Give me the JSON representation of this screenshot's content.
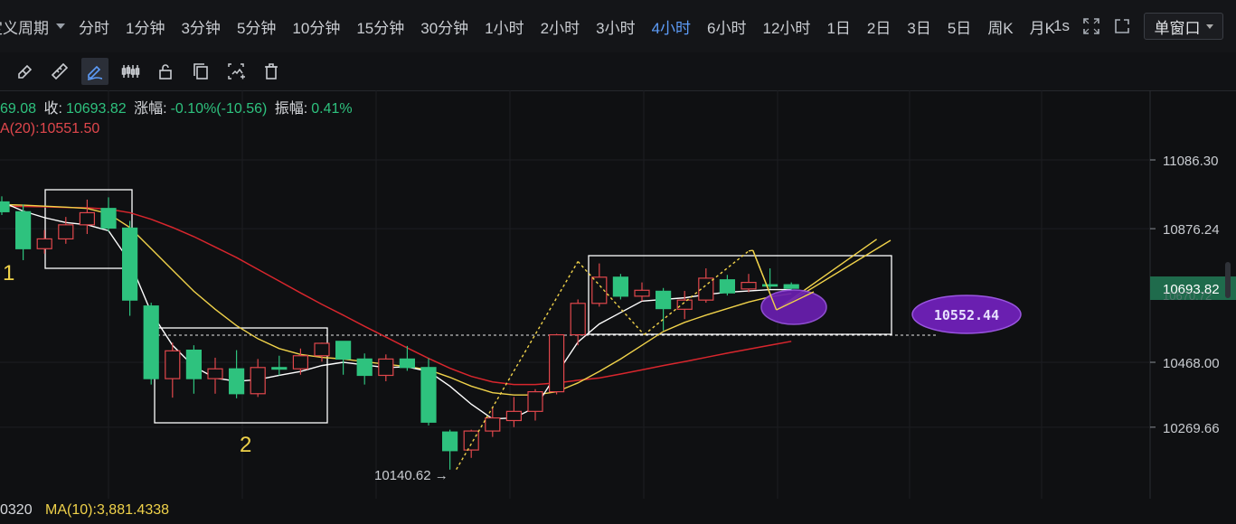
{
  "header": {
    "custom_period_label": "定义周期",
    "timeframes": [
      "分时",
      "1分钟",
      "3分钟",
      "5分钟",
      "10分钟",
      "15分钟",
      "30分钟",
      "1小时",
      "2小时",
      "3小时",
      "4小时",
      "6小时",
      "12小时",
      "1日",
      "2日",
      "3日",
      "5日",
      "周K",
      "月K"
    ],
    "active_timeframe": "4小时",
    "right_refresh": "1s",
    "window_mode": "单窗口"
  },
  "toolbar": {
    "tools": [
      "ruler-eraser-icon",
      "ruler-icon",
      "pen-draw-icon",
      "candle-pattern-icon",
      "lock-icon",
      "copy-icon",
      "screenshot-icon",
      "trash-icon"
    ],
    "active_tool": "pen-draw-icon"
  },
  "info": {
    "open_fragment": "69.08",
    "close_label": "收:",
    "close_value": "10693.82",
    "change_label": "涨幅:",
    "change_value": "-0.10%(-10.56)",
    "amplitude_label": "振幅:",
    "amplitude_value": "0.41%",
    "ma20_fragment": "A(20):10551.50"
  },
  "bottom": {
    "volume_fragment": "0320",
    "ma10_label": "MA(10):3,881.4338"
  },
  "colors": {
    "up": "#e0474c",
    "down": "#2ec27e",
    "ma_fast": "#ffffff",
    "ma_mid": "#f0d24a",
    "ma_slow": "#d8262d",
    "annotation": "#ffffff",
    "accent_purple": "#6a1fb0",
    "price_tag": "#1f6b4c"
  },
  "chart_data": {
    "type": "candlestick",
    "y_ticks": [
      11086.3,
      10876.24,
      10468.0,
      10269.66
    ],
    "y_tick_labels": [
      "11086.30",
      "10876.24",
      "10468.00",
      "10269.66"
    ],
    "ylim": [
      10060,
      11300
    ],
    "current_price_label": "10693.82",
    "current_price_hidden_label": "10670.72",
    "current_price": 10693.82,
    "low_marker_label": "10140.62",
    "low_marker": 10140.62,
    "ellipse_label": "10552.44",
    "support_level": 10552.44,
    "box_labels": [
      "1",
      "2"
    ],
    "candles": [
      {
        "o": 10958,
        "c": 10928,
        "h": 10975,
        "l": 10918
      },
      {
        "o": 10928,
        "c": 10815,
        "h": 10950,
        "l": 10780
      },
      {
        "o": 10815,
        "c": 10845,
        "h": 10872,
        "l": 10800
      },
      {
        "o": 10845,
        "c": 10888,
        "h": 10912,
        "l": 10830
      },
      {
        "o": 10888,
        "c": 10925,
        "h": 10965,
        "l": 10860
      },
      {
        "o": 10938,
        "c": 10878,
        "h": 10972,
        "l": 10868
      },
      {
        "o": 10878,
        "c": 10658,
        "h": 10900,
        "l": 10610
      },
      {
        "o": 10640,
        "c": 10418,
        "h": 10650,
        "l": 10400
      },
      {
        "o": 10418,
        "c": 10503,
        "h": 10528,
        "l": 10360
      },
      {
        "o": 10505,
        "c": 10418,
        "h": 10520,
        "l": 10372
      },
      {
        "o": 10418,
        "c": 10448,
        "h": 10482,
        "l": 10372
      },
      {
        "o": 10448,
        "c": 10372,
        "h": 10505,
        "l": 10358
      },
      {
        "o": 10372,
        "c": 10452,
        "h": 10478,
        "l": 10362
      },
      {
        "o": 10452,
        "c": 10447,
        "h": 10488,
        "l": 10428
      },
      {
        "o": 10448,
        "c": 10488,
        "h": 10510,
        "l": 10430
      },
      {
        "o": 10488,
        "c": 10526,
        "h": 10528,
        "l": 10470
      },
      {
        "o": 10532,
        "c": 10478,
        "h": 10532,
        "l": 10430
      },
      {
        "o": 10478,
        "c": 10428,
        "h": 10495,
        "l": 10400
      },
      {
        "o": 10428,
        "c": 10478,
        "h": 10492,
        "l": 10410
      },
      {
        "o": 10478,
        "c": 10452,
        "h": 10518,
        "l": 10442
      },
      {
        "o": 10452,
        "c": 10285,
        "h": 10480,
        "l": 10275
      },
      {
        "o": 10255,
        "c": 10198,
        "h": 10262,
        "l": 10140
      },
      {
        "o": 10200,
        "c": 10258,
        "h": 10262,
        "l": 10176
      },
      {
        "o": 10258,
        "c": 10298,
        "h": 10330,
        "l": 10240
      },
      {
        "o": 10290,
        "c": 10318,
        "h": 10362,
        "l": 10270
      },
      {
        "o": 10318,
        "c": 10378,
        "h": 10386,
        "l": 10290
      },
      {
        "o": 10378,
        "c": 10552,
        "h": 10555,
        "l": 10370
      },
      {
        "o": 10552,
        "c": 10648,
        "h": 10660,
        "l": 10520
      },
      {
        "o": 10648,
        "c": 10728,
        "h": 10770,
        "l": 10638
      },
      {
        "o": 10728,
        "c": 10670,
        "h": 10738,
        "l": 10660
      },
      {
        "o": 10670,
        "c": 10688,
        "h": 10712,
        "l": 10655
      },
      {
        "o": 10685,
        "c": 10632,
        "h": 10695,
        "l": 10565
      },
      {
        "o": 10630,
        "c": 10658,
        "h": 10686,
        "l": 10600
      },
      {
        "o": 10658,
        "c": 10725,
        "h": 10755,
        "l": 10650
      },
      {
        "o": 10720,
        "c": 10680,
        "h": 10735,
        "l": 10672
      },
      {
        "o": 10692,
        "c": 10712,
        "h": 10738,
        "l": 10682
      },
      {
        "o": 10705,
        "c": 10702,
        "h": 10755,
        "l": 10692
      },
      {
        "o": 10705,
        "c": 10694,
        "h": 10712,
        "l": 10688
      }
    ],
    "ma_fast": [
      10958,
      10930,
      10910,
      10895,
      10888,
      10870,
      10775,
      10620,
      10520,
      10455,
      10420,
      10410,
      10415,
      10428,
      10440,
      10458,
      10468,
      10460,
      10452,
      10454,
      10440,
      10395,
      10340,
      10295,
      10298,
      10330,
      10432,
      10530,
      10585,
      10620,
      10655,
      10660,
      10665,
      10675,
      10682,
      10686,
      10690,
      10690
    ],
    "ma_mid": [
      10950,
      10948,
      10945,
      10942,
      10938,
      10922,
      10880,
      10815,
      10750,
      10685,
      10630,
      10580,
      10540,
      10510,
      10492,
      10483,
      10478,
      10470,
      10462,
      10455,
      10445,
      10422,
      10395,
      10375,
      10368,
      10368,
      10378,
      10405,
      10440,
      10478,
      10520,
      10562,
      10590,
      10612,
      10632,
      10652,
      10668,
      10678
    ],
    "ma_slow": [
      10945,
      10944,
      10943,
      10941,
      10940,
      10936,
      10925,
      10905,
      10880,
      10852,
      10820,
      10788,
      10752,
      10716,
      10680,
      10645,
      10612,
      10578,
      10545,
      10512,
      10480,
      10450,
      10425,
      10408,
      10400,
      10400,
      10405,
      10413,
      10420,
      10432,
      10445,
      10458,
      10470,
      10483,
      10496,
      10508,
      10520,
      10532
    ],
    "zigzag": [
      {
        "i": 21.3,
        "p": 10140.62
      },
      {
        "i": 27,
        "p": 10776
      },
      {
        "i": 30.1,
        "p": 10552.44
      },
      {
        "i": 35,
        "p": 10808
      },
      {
        "i": 35.2,
        "p": 10810
      },
      {
        "i": 36.3,
        "p": 10628
      },
      {
        "i": 41,
        "p": 10844
      }
    ]
  }
}
